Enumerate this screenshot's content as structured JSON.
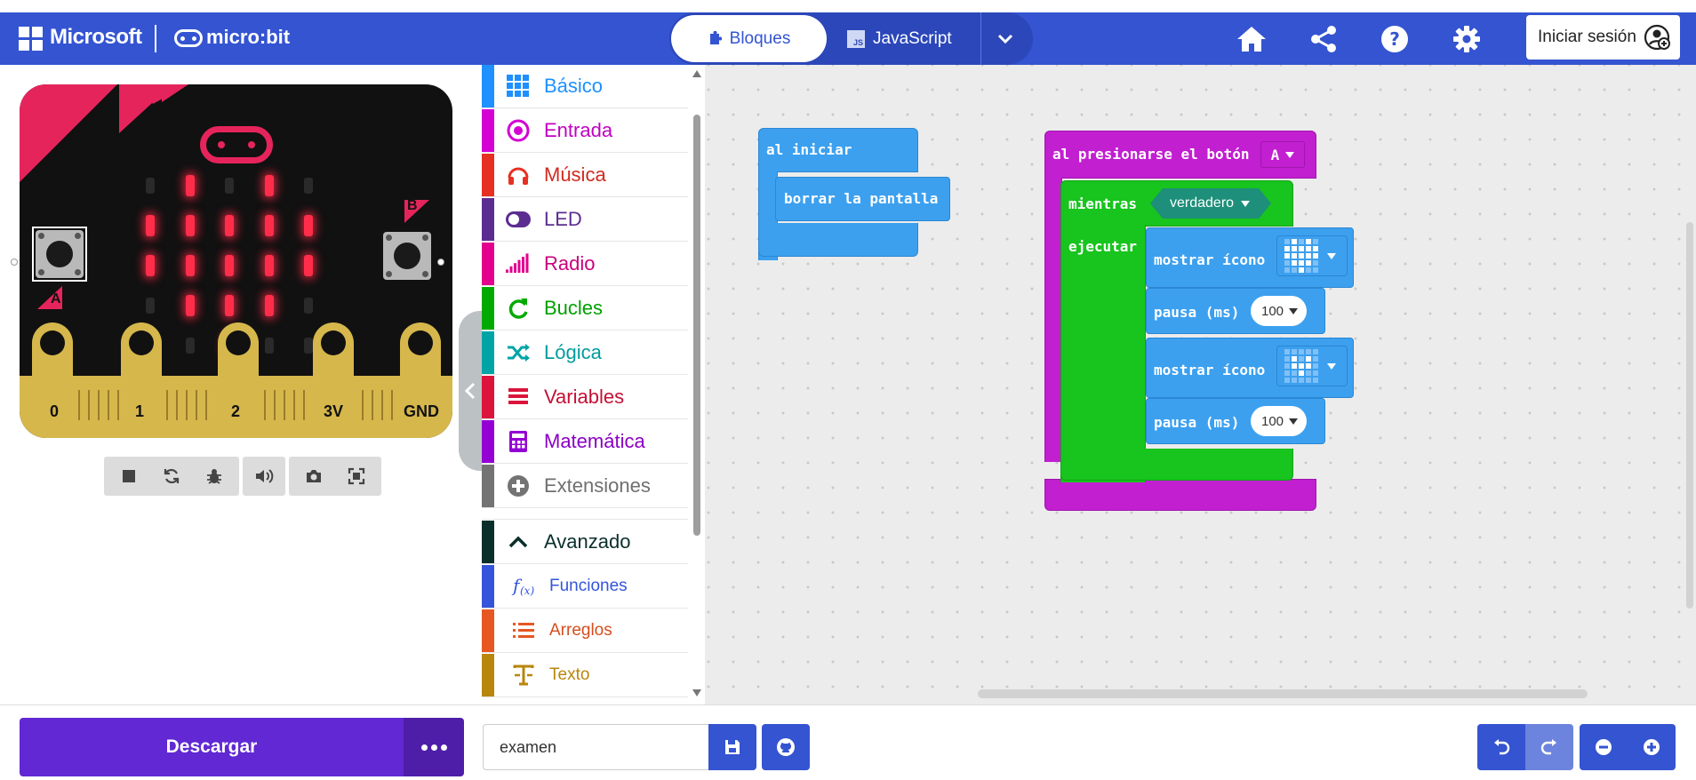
{
  "header": {
    "brand": "Microsoft",
    "product": "micro:bit",
    "tabs": [
      {
        "label": "Bloques",
        "active": true
      },
      {
        "label": "JavaScript",
        "active": false
      }
    ],
    "js_icon_text": "JS",
    "signin_label": "Iniciar sesión"
  },
  "colors": {
    "header_bg": "#3454d1",
    "download": "#6128d3",
    "block_blue": "#3ca0ef",
    "block_purple": "#c21fd1",
    "block_green": "#18c41e",
    "led_on": "#ff2d4a"
  },
  "simulator": {
    "pins": [
      "0",
      "1",
      "2",
      "3V",
      "GND"
    ],
    "button_a": "A",
    "button_b": "B",
    "led_matrix": [
      [
        0,
        1,
        0,
        1,
        0
      ],
      [
        1,
        1,
        1,
        1,
        1
      ],
      [
        1,
        1,
        1,
        1,
        1
      ],
      [
        0,
        1,
        1,
        1,
        0
      ],
      [
        0,
        0,
        1,
        0,
        0
      ]
    ],
    "toolbar_icons": [
      "stop-icon",
      "restart-icon",
      "debug-icon",
      "sound-icon",
      "screenshot-icon",
      "fullscreen-icon"
    ]
  },
  "toolbox": {
    "categories": [
      {
        "label": "Básico",
        "color": "#1e90ff",
        "text": "#1e90ff",
        "icon": "grid-icon"
      },
      {
        "label": "Entrada",
        "color": "#d400d4",
        "text": "#c100c1",
        "icon": "target-icon"
      },
      {
        "label": "Música",
        "color": "#e63022",
        "text": "#d12a1e",
        "icon": "headphones-icon"
      },
      {
        "label": "LED",
        "color": "#5c2d91",
        "text": "#5c2d91",
        "icon": "toggle-icon"
      },
      {
        "label": "Radio",
        "color": "#e3008c",
        "text": "#c9007d",
        "icon": "signal-icon"
      },
      {
        "label": "Bucles",
        "color": "#00aa00",
        "text": "#00a000",
        "icon": "loop-icon"
      },
      {
        "label": "Lógica",
        "color": "#00a4a6",
        "text": "#009c9e",
        "icon": "shuffle-icon"
      },
      {
        "label": "Variables",
        "color": "#dc143c",
        "text": "#c41035",
        "icon": "list-lines-icon"
      },
      {
        "label": "Matemática",
        "color": "#9400d3",
        "text": "#8a00c4",
        "icon": "calculator-icon"
      },
      {
        "label": "Extensiones",
        "color": "#737373",
        "text": "#6f6f6f",
        "icon": "plus-circle-icon"
      }
    ],
    "advanced": {
      "label": "Avanzado",
      "color": "#0a2f2a",
      "text": "#0a2f2a"
    },
    "subcategories": [
      {
        "label": "Funciones",
        "color": "#3455db",
        "text": "#3455db",
        "icon": "function-icon"
      },
      {
        "label": "Arreglos",
        "color": "#e65722",
        "text": "#d44f1e",
        "icon": "array-icon"
      },
      {
        "label": "Texto",
        "color": "#b8860b",
        "text": "#b8860b",
        "icon": "text-icon"
      }
    ]
  },
  "workspace": {
    "on_start": {
      "header": "al iniciar",
      "body": "borrar la pantalla"
    },
    "on_button": {
      "header": "al presionarse el botón",
      "button": "A"
    },
    "while_block": {
      "label": "mientras",
      "condition": "verdadero",
      "do_label": "ejecutar"
    },
    "statements": [
      {
        "type": "show_icon",
        "label": "mostrar ícono",
        "icon": "big-heart"
      },
      {
        "type": "pause",
        "label": "pausa (ms)",
        "value": "100"
      },
      {
        "type": "show_icon",
        "label": "mostrar ícono",
        "icon": "small-heart"
      },
      {
        "type": "pause",
        "label": "pausa (ms)",
        "value": "100"
      }
    ],
    "icon_patterns": {
      "big-heart": [
        [
          0,
          1,
          0,
          1,
          0
        ],
        [
          1,
          1,
          1,
          1,
          1
        ],
        [
          1,
          1,
          1,
          1,
          1
        ],
        [
          0,
          1,
          1,
          1,
          0
        ],
        [
          0,
          0,
          1,
          0,
          0
        ]
      ],
      "small-heart": [
        [
          0,
          0,
          0,
          0,
          0
        ],
        [
          0,
          1,
          0,
          1,
          0
        ],
        [
          0,
          1,
          1,
          1,
          0
        ],
        [
          0,
          0,
          1,
          0,
          0
        ],
        [
          0,
          0,
          0,
          0,
          0
        ]
      ]
    }
  },
  "footer": {
    "download_label": "Descargar",
    "project_name": "examen"
  }
}
